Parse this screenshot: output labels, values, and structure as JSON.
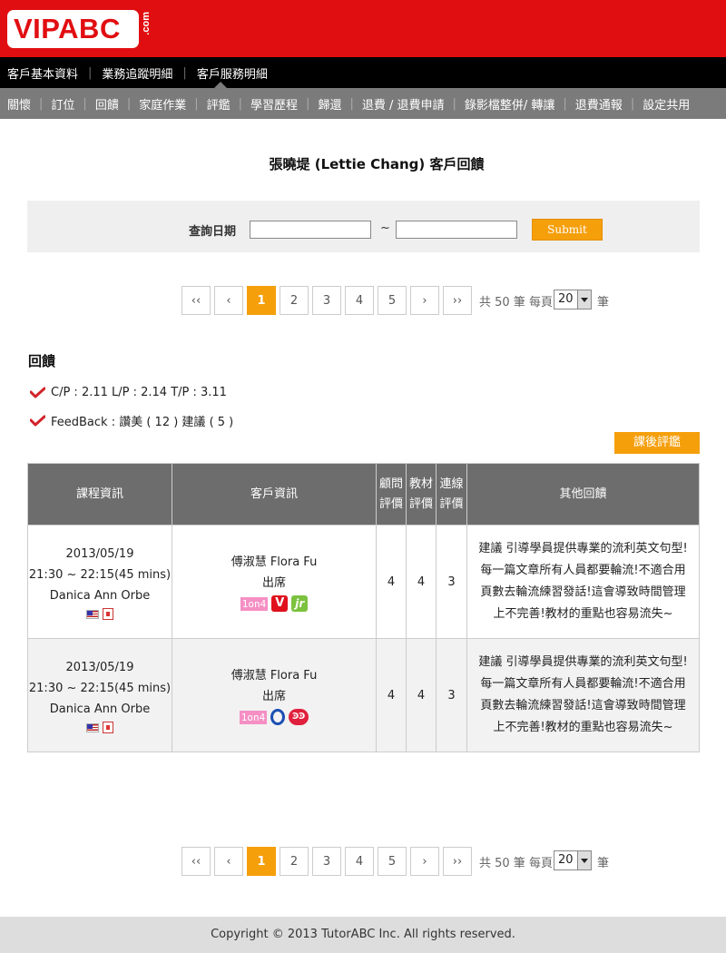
{
  "brand": {
    "logo_text": "VIPABC",
    "logo_suffix": ".com"
  },
  "nav_primary": [
    "客戶基本資料",
    "業務追蹤明細",
    "客戶服務明細"
  ],
  "nav_secondary": [
    "關懷",
    "訂位",
    "回饋",
    "家庭作業",
    "評鑑",
    "學習歷程",
    "歸還",
    "退費 / 退費申請",
    "錄影檔整併/ 轉讓",
    "退費通報",
    "設定共用"
  ],
  "page_title": "張曉堤 (Lettie Chang) 客戶回饋",
  "search": {
    "label": "查詢日期",
    "tilde": "~",
    "from_value": "",
    "to_value": "",
    "submit_label": "Submit"
  },
  "pager": {
    "first": "‹‹",
    "prev": "‹",
    "pages": [
      "1",
      "2",
      "3",
      "4",
      "5"
    ],
    "active_page": "1",
    "next": "›",
    "last": "››",
    "total_text": "共 50 筆 每頁",
    "page_size": "20",
    "unit": "筆"
  },
  "feedback": {
    "title": "回饋",
    "scores_line": "C/P : 2.11 L/P : 2.14 T/P : 3.11",
    "feedback_line": "FeedBack : 讚美 ( 12 ) 建議 ( 5 )",
    "after_class_button": "課後評鑑"
  },
  "table": {
    "headers": {
      "course": "課程資訊",
      "customer": "客戶資訊",
      "consultant_rating_1": "顧問",
      "consultant_rating_2": "評價",
      "material_rating_1": "教材",
      "material_rating_2": "評價",
      "connection_rating_1": "連線",
      "connection_rating_2": "評價",
      "other": "其他回饋"
    },
    "rows": [
      {
        "date": "2013/05/19",
        "time": "21:30 ~ 22:15(45 mins)",
        "consultant": "Danica Ann Orbe",
        "customer_name": "傅淑慧 Flora Fu",
        "attendance": "出席",
        "badge_text": "1on4",
        "consultant_rating": "4",
        "material_rating": "4",
        "connection_rating": "3",
        "other_feedback": "建議 引導學員提供專業的流利英文句型!每一篇文章所有人員都要輪流!不適合用頁數去輪流練習發話!這會導致時間管理上不完善!教材的重點也容易流失~"
      },
      {
        "date": "2013/05/19",
        "time": "21:30 ~ 22:15(45 mins)",
        "consultant": "Danica Ann Orbe",
        "customer_name": "傅淑慧 Flora Fu",
        "attendance": "出席",
        "badge_text": "1on4",
        "consultant_rating": "4",
        "material_rating": "4",
        "connection_rating": "3",
        "other_feedback": "建議 引導學員提供專業的流利英文句型!每一篇文章所有人員都要輪流!不適合用頁數去輪流練習發話!這會導致時間管理上不完善!教材的重點也容易流失~"
      }
    ]
  },
  "footer": {
    "copyright": "Copyright © 2013 TutorABC Inc. All rights reserved."
  }
}
